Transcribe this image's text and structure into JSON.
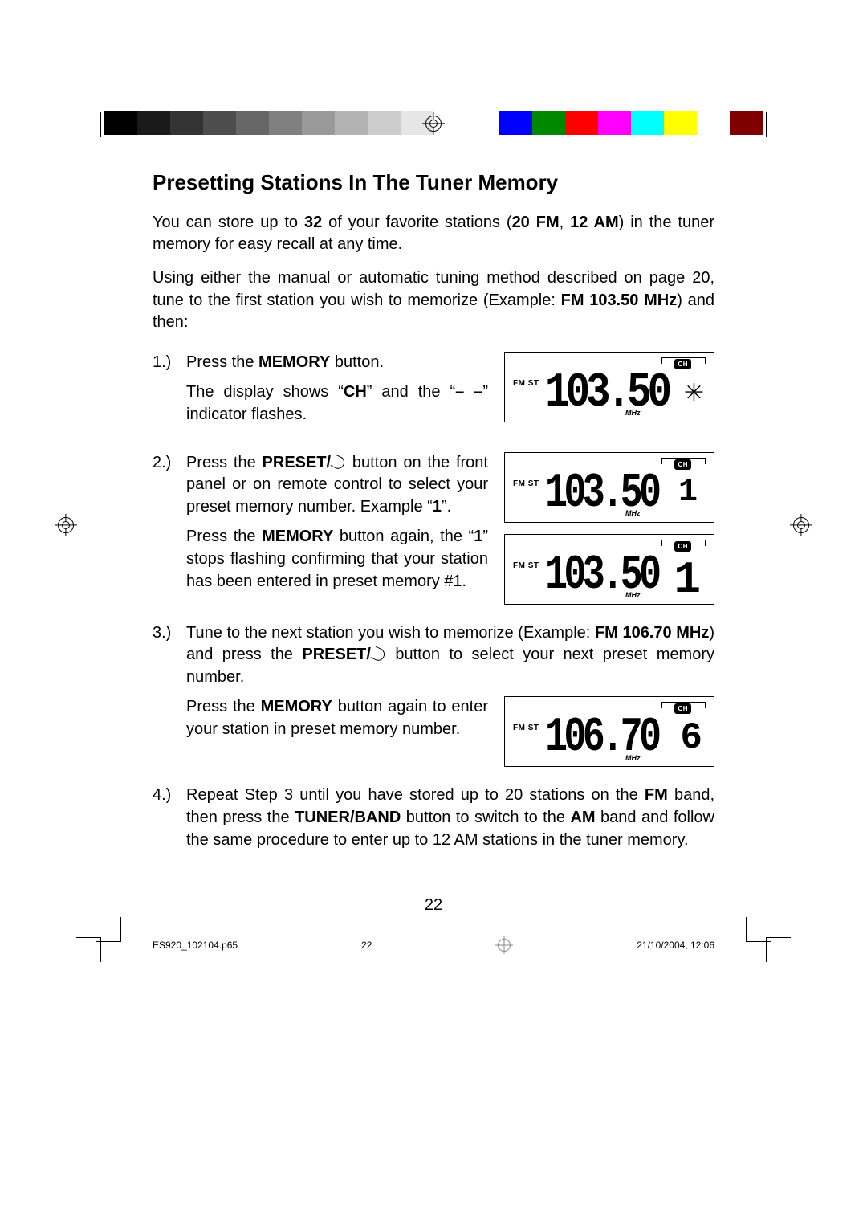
{
  "heading": "Presetting Stations In The Tuner Memory",
  "intro1_a": "You can store up to ",
  "intro1_b": "32",
  "intro1_c": " of your favorite stations (",
  "intro1_d": "20 FM",
  "intro1_e": ", ",
  "intro1_f": "12 AM",
  "intro1_g": ") in the tuner memory for easy recall at any time.",
  "intro2_a": "Using either the manual or automatic tuning method described on page 20, tune to the first station you wish to memorize (Example: ",
  "intro2_b": "FM 103.50 MHz",
  "intro2_c": ") and then:",
  "step1_num": "1.)",
  "step1_a": "Press the ",
  "step1_b": "MEMORY",
  "step1_c": " button.",
  "step1_d": "The display shows “",
  "step1_e": "CH",
  "step1_f": "” and the “",
  "step1_g": "– –",
  "step1_h": "” indicator flashes.",
  "step2_num": "2.)",
  "step2_a": "Press the ",
  "step2_b": "PRESET/",
  "step2_c": " button on the front panel or on remote control to select your preset memory number. Example “",
  "step2_d": "1",
  "step2_e": "”.",
  "step2_f": "Press the ",
  "step2_g": "MEMORY",
  "step2_h": " button again, the “",
  "step2_i": "1",
  "step2_j": "” stops flashing confirming that your station has been entered in preset memory #1.",
  "step3_num": "3.)",
  "step3_a": "Tune to the next station you wish to memorize (Example: ",
  "step3_b": "FM 106.70 MHz",
  "step3_c": ") and press the ",
  "step3_d": "PRESET/",
  "step3_e": " button to select your next preset memory number.",
  "step3_f": "Press the ",
  "step3_g": "MEMORY",
  "step3_h": " button again to enter your station in preset memory number.",
  "step4_num": "4.)",
  "step4_a": "Repeat Step 3 until you have stored up to 20 stations on the ",
  "step4_b": "FM",
  "step4_c": " band, then press the ",
  "step4_d": "TUNER/BAND",
  "step4_e": " button to switch to the ",
  "step4_f": "AM",
  "step4_g": " band and follow the same procedure to enter up to 12 AM stations in the tuner memory.",
  "lcd": {
    "fmst": "FM ST",
    "mhz": "MHz",
    "ch": "CH",
    "freq1": "103.50",
    "freq2": "103.50",
    "freq3": "103.50",
    "freq4": "106.70",
    "preset2": "1",
    "preset3": "1",
    "preset4": "6"
  },
  "page_number": "22",
  "footer": {
    "file": "ES920_102104.p65",
    "page": "22",
    "date": "21/10/2004, 12:06"
  },
  "colorbar": [
    "#000000",
    "#1a1a1a",
    "#333333",
    "#4d4d4d",
    "#666666",
    "#808080",
    "#999999",
    "#b3b3b3",
    "#cccccc",
    "#e6e6e6",
    "#ffffff",
    "#ffffff",
    "#0000ff",
    "#008000",
    "#ff0000",
    "#ff00ff",
    "#00ffff",
    "#ffff00",
    "#ffffff",
    "#800000"
  ]
}
